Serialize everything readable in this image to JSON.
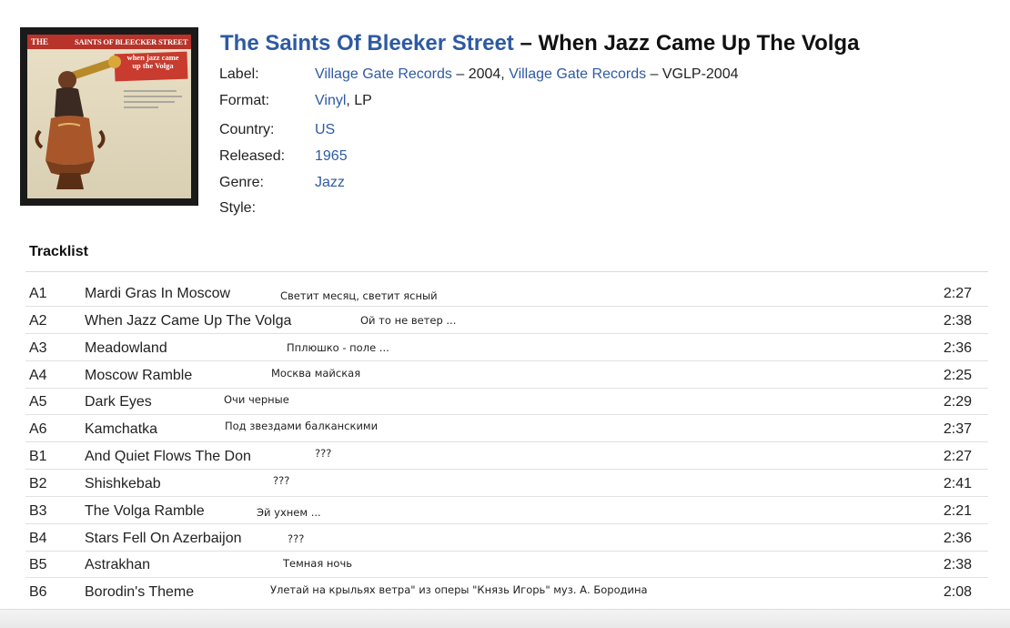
{
  "release": {
    "artist": "The Saints Of Bleeker Street",
    "separator": " – ",
    "album": "When Jazz Came Up The Volga"
  },
  "cover": {
    "the": "THE",
    "band": "SAINTS OF BLEECKER STREET",
    "sticker_line1": "when jazz came",
    "sticker_line2": "up the Volga"
  },
  "info": {
    "label": {
      "label": "Label:",
      "link1": "Village Gate Records",
      "text1": " – 2004, ",
      "link2": "Village Gate Records",
      "text2": " – VGLP-2004"
    },
    "format": {
      "label": "Format:",
      "link": "Vinyl",
      "text": ", LP"
    },
    "country": {
      "label": "Country:",
      "value": "US"
    },
    "released": {
      "label": "Released:",
      "value": "1965"
    },
    "genre": {
      "label": "Genre:",
      "value": "Jazz"
    },
    "style": {
      "label": "Style:"
    }
  },
  "tracklist": {
    "title": "Tracklist",
    "tracks": [
      {
        "pos": "A1",
        "title": "Mardi Gras In Moscow",
        "duration": "2:27",
        "note": "Светит месяц, светит ясный"
      },
      {
        "pos": "A2",
        "title": "When Jazz Came Up The Volga",
        "duration": "2:38",
        "note": "Ой то не ветер ..."
      },
      {
        "pos": "A3",
        "title": "Meadowland",
        "duration": "2:36",
        "note": "Пплюшко - поле ..."
      },
      {
        "pos": "A4",
        "title": "Moscow Ramble",
        "duration": "2:25",
        "note": "Москва майская"
      },
      {
        "pos": "A5",
        "title": "Dark Eyes",
        "duration": "2:29",
        "note": "Очи черные"
      },
      {
        "pos": "A6",
        "title": "Kamchatka",
        "duration": "2:37",
        "note": "Под звездами балканскими"
      },
      {
        "pos": "B1",
        "title": "And Quiet Flows The Don",
        "duration": "2:27",
        "note": "???"
      },
      {
        "pos": "B2",
        "title": "Shishkebab",
        "duration": "2:41",
        "note": "???"
      },
      {
        "pos": "B3",
        "title": "The Volga Ramble",
        "duration": "2:21",
        "note": "Эй ухнем ..."
      },
      {
        "pos": "B4",
        "title": "Stars Fell On Azerbaijon",
        "duration": "2:36",
        "note": "???"
      },
      {
        "pos": "B5",
        "title": "Astrakhan",
        "duration": "2:38",
        "note": "Темная ночь"
      },
      {
        "pos": "B6",
        "title": "Borodin's Theme",
        "duration": "2:08",
        "note": "Улетай на крыльях ветра\" из оперы \"Князь Игорь\" муз. А. Бородина"
      }
    ]
  }
}
